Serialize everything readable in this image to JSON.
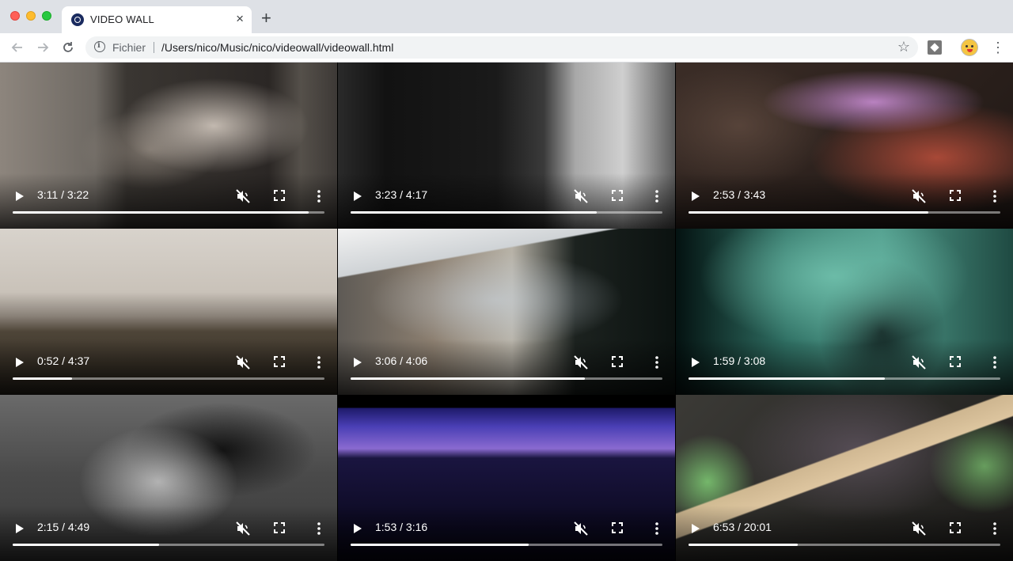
{
  "browser": {
    "tab_title": "VIDEO WALL",
    "tab_close": "×",
    "new_tab": "+",
    "scheme_label": "Fichier",
    "url": "/Users/nico/Music/nico/videowall/videowall.html"
  },
  "videos": [
    {
      "time": "3:11 / 3:22",
      "progress": 0.95
    },
    {
      "time": "3:23 / 4:17",
      "progress": 0.79
    },
    {
      "time": "2:53 / 3:43",
      "progress": 0.77
    },
    {
      "time": "0:52 / 4:37",
      "progress": 0.19
    },
    {
      "time": "3:06 / 4:06",
      "progress": 0.75
    },
    {
      "time": "1:59 / 3:08",
      "progress": 0.63
    },
    {
      "time": "2:15 / 4:49",
      "progress": 0.47
    },
    {
      "time": "1:53 / 3:16",
      "progress": 0.57
    },
    {
      "time": "6:53 / 20:01",
      "progress": 0.35
    }
  ]
}
